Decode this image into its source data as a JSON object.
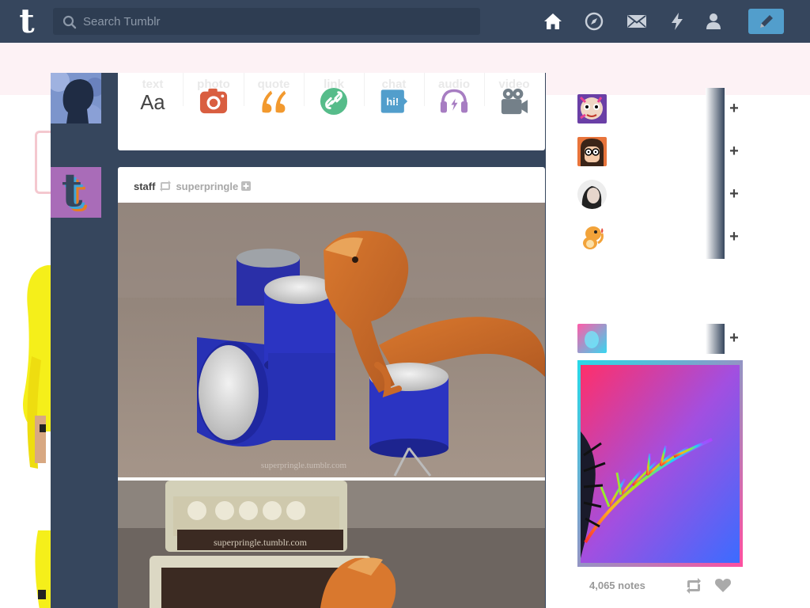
{
  "header": {
    "search_placeholder": "Search Tumblr",
    "nav_icons": [
      "home-icon",
      "explore-icon",
      "inbox-icon",
      "activity-icon",
      "account-icon"
    ],
    "compose_icon": "pencil-icon",
    "colors": {
      "navy": "#36465d",
      "search_bg": "#2e3d52",
      "compose_blue": "#529ecc"
    }
  },
  "post_types": [
    {
      "label": "text",
      "icon": "text-icon",
      "color": "#444444"
    },
    {
      "label": "photo",
      "icon": "camera-icon",
      "color": "#d95e40"
    },
    {
      "label": "quote",
      "icon": "quote-icon",
      "color": "#f2992e"
    },
    {
      "label": "link",
      "icon": "link-icon",
      "color": "#56bc8a"
    },
    {
      "label": "chat",
      "icon": "chat-icon",
      "color": "#529ecc"
    },
    {
      "label": "audio",
      "icon": "headphones-icon",
      "color": "#a77dc2"
    },
    {
      "label": "video",
      "icon": "video-camera-icon",
      "color": "#748089"
    }
  ],
  "post": {
    "author": "staff",
    "reblog_source": "superpringle",
    "photo1_watermark": "superpringle.tumblr.com",
    "photo2_watermark": "superpringle.tumblr.com"
  },
  "sidebar": {
    "recommended_count": 4,
    "radar": {
      "notes": "4,065 notes"
    }
  }
}
